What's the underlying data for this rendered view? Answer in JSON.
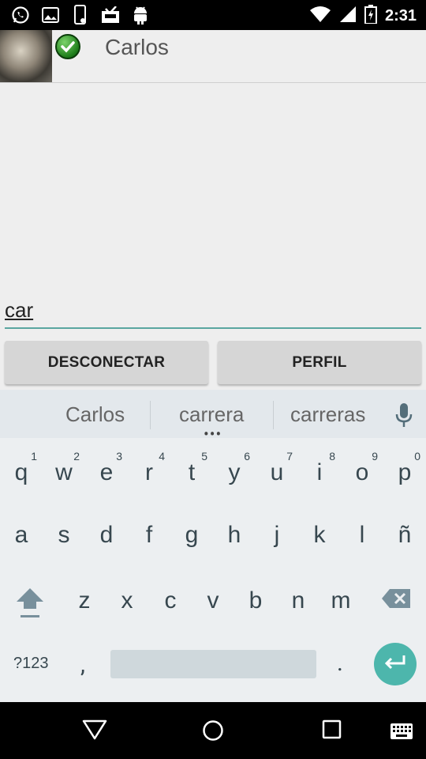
{
  "status_bar": {
    "time": "2:31",
    "icons": [
      "whatsapp-icon",
      "image-icon",
      "phone-icon",
      "inbox-icon",
      "android-icon",
      "wifi-icon",
      "signal-icon",
      "battery-icon"
    ]
  },
  "header": {
    "contact_name": "Carlos",
    "avatar": "contact-avatar",
    "status": "online-check-icon"
  },
  "message_input": {
    "value": "car"
  },
  "buttons": {
    "disconnect": "DESCONECTAR",
    "profile": "PERFIL"
  },
  "keyboard": {
    "suggestions": [
      "Carlos",
      "carrera",
      "carreras"
    ],
    "more_indicator": "•••",
    "row1": [
      {
        "key": "q",
        "hint": "1"
      },
      {
        "key": "w",
        "hint": "2"
      },
      {
        "key": "e",
        "hint": "3"
      },
      {
        "key": "r",
        "hint": "4"
      },
      {
        "key": "t",
        "hint": "5"
      },
      {
        "key": "y",
        "hint": "6"
      },
      {
        "key": "u",
        "hint": "7"
      },
      {
        "key": "i",
        "hint": "8"
      },
      {
        "key": "o",
        "hint": "9"
      },
      {
        "key": "p",
        "hint": "0"
      }
    ],
    "row2": [
      "a",
      "s",
      "d",
      "f",
      "g",
      "h",
      "j",
      "k",
      "l",
      "ñ"
    ],
    "row3": [
      "z",
      "x",
      "c",
      "v",
      "b",
      "n",
      "m"
    ],
    "symbols_key": "?123",
    "comma_key": ",",
    "period_key": ".",
    "accent_color": "#4db6ac"
  },
  "nav_bar": {
    "icons": [
      "back-icon",
      "home-icon",
      "recents-icon",
      "keyboard-switch-icon"
    ]
  }
}
